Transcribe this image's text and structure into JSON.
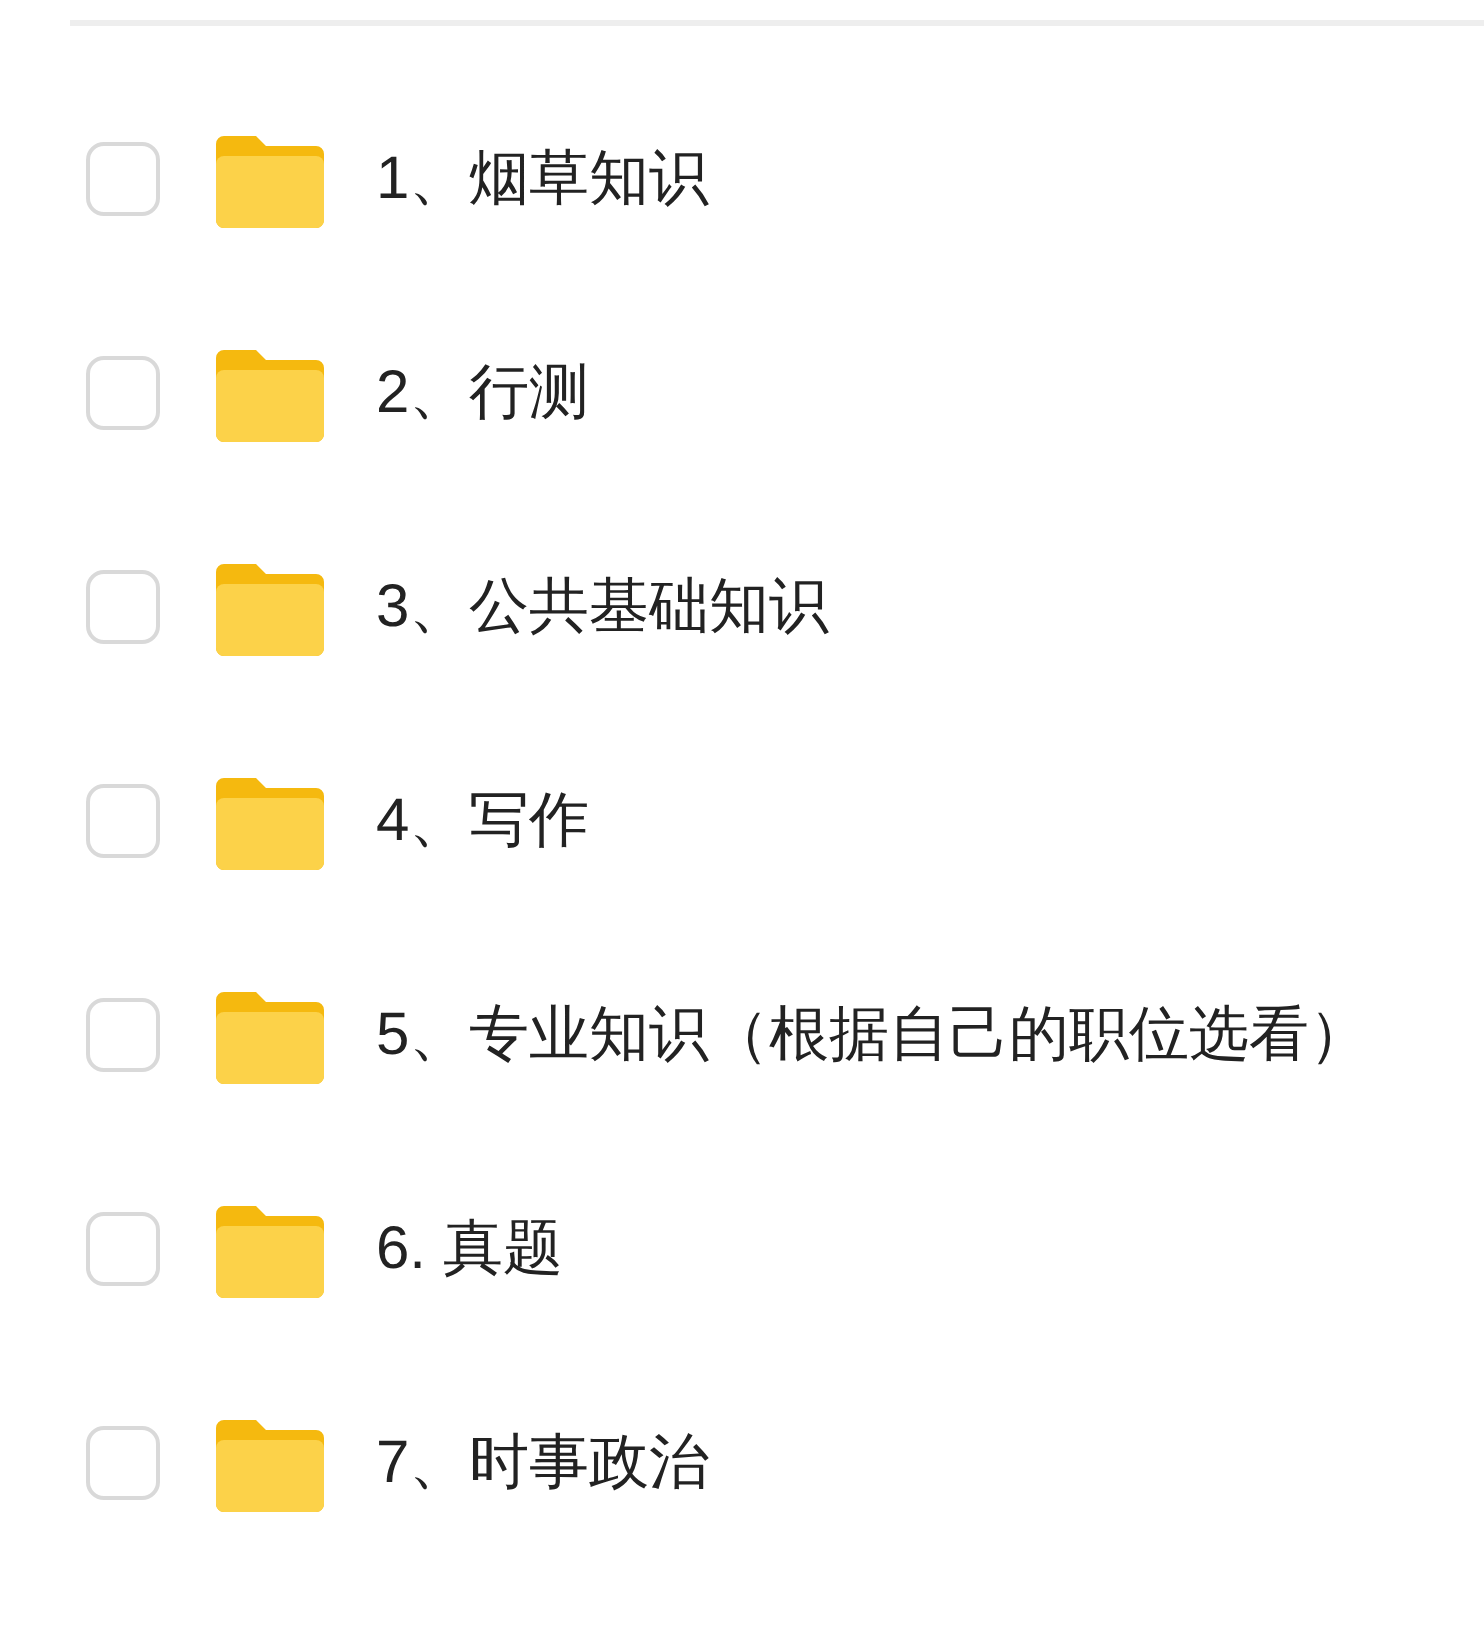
{
  "folders": [
    {
      "name": "1、烟草知识",
      "checked": false
    },
    {
      "name": "2、行测",
      "checked": false
    },
    {
      "name": "3、公共基础知识",
      "checked": false
    },
    {
      "name": "4、写作",
      "checked": false
    },
    {
      "name": "5、专业知识（根据自己的职位选看）",
      "checked": false
    },
    {
      "name": "6. 真题",
      "checked": false
    },
    {
      "name": "7、时事政治",
      "checked": false
    }
  ]
}
